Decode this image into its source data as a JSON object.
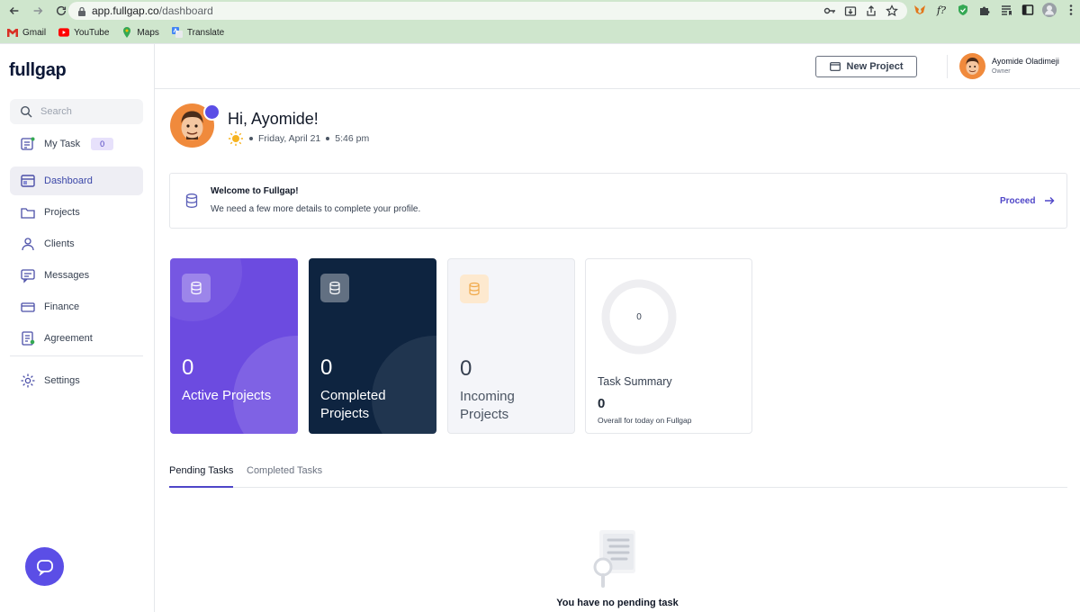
{
  "browser": {
    "url_host": "app.fullgap.co",
    "url_path": "/dashboard",
    "bookmarks": [
      {
        "label": "Gmail",
        "icon": "gmail-icon"
      },
      {
        "label": "YouTube",
        "icon": "youtube-icon"
      },
      {
        "label": "Maps",
        "icon": "maps-icon"
      },
      {
        "label": "Translate",
        "icon": "translate-icon"
      }
    ]
  },
  "sidebar": {
    "logo": "fullgap",
    "search_placeholder": "Search",
    "my_task": {
      "label": "My Task",
      "count": "0"
    },
    "items": [
      {
        "label": "Dashboard",
        "icon": "dashboard-icon",
        "active": true
      },
      {
        "label": "Projects",
        "icon": "folder-icon"
      },
      {
        "label": "Clients",
        "icon": "clients-icon"
      },
      {
        "label": "Messages",
        "icon": "messages-icon"
      },
      {
        "label": "Finance",
        "icon": "finance-icon"
      },
      {
        "label": "Agreement",
        "icon": "agreement-icon"
      },
      {
        "label": "Settings",
        "icon": "gear-icon"
      }
    ]
  },
  "topbar": {
    "new_project_label": "New Project",
    "user_name": "Ayomide Oladimeji",
    "user_role": "Owner"
  },
  "greeting": {
    "title": "Hi, Ayomide!",
    "date": "Friday, April 21",
    "time": "5:46 pm"
  },
  "banner": {
    "title": "Welcome to Fullgap!",
    "description": "We need a few more details to complete your profile.",
    "action": "Proceed"
  },
  "cards": [
    {
      "value": "0",
      "label": "Active Projects"
    },
    {
      "value": "0",
      "label": "Completed Projects"
    },
    {
      "value": "0",
      "label": "Incoming Projects"
    }
  ],
  "task_summary": {
    "ring_value": "0",
    "title": "Task Summary",
    "count": "0",
    "caption": "Overall for today on Fullgap"
  },
  "tabs": [
    {
      "label": "Pending Tasks",
      "active": true
    },
    {
      "label": "Completed Tasks",
      "active": false
    }
  ],
  "empty_state": "You have no pending task",
  "colors": {
    "accent": "#5b4ee6",
    "active_card": "#6c4be0",
    "completed_card": "#0e2440",
    "chrome": "#cfe6cd"
  }
}
